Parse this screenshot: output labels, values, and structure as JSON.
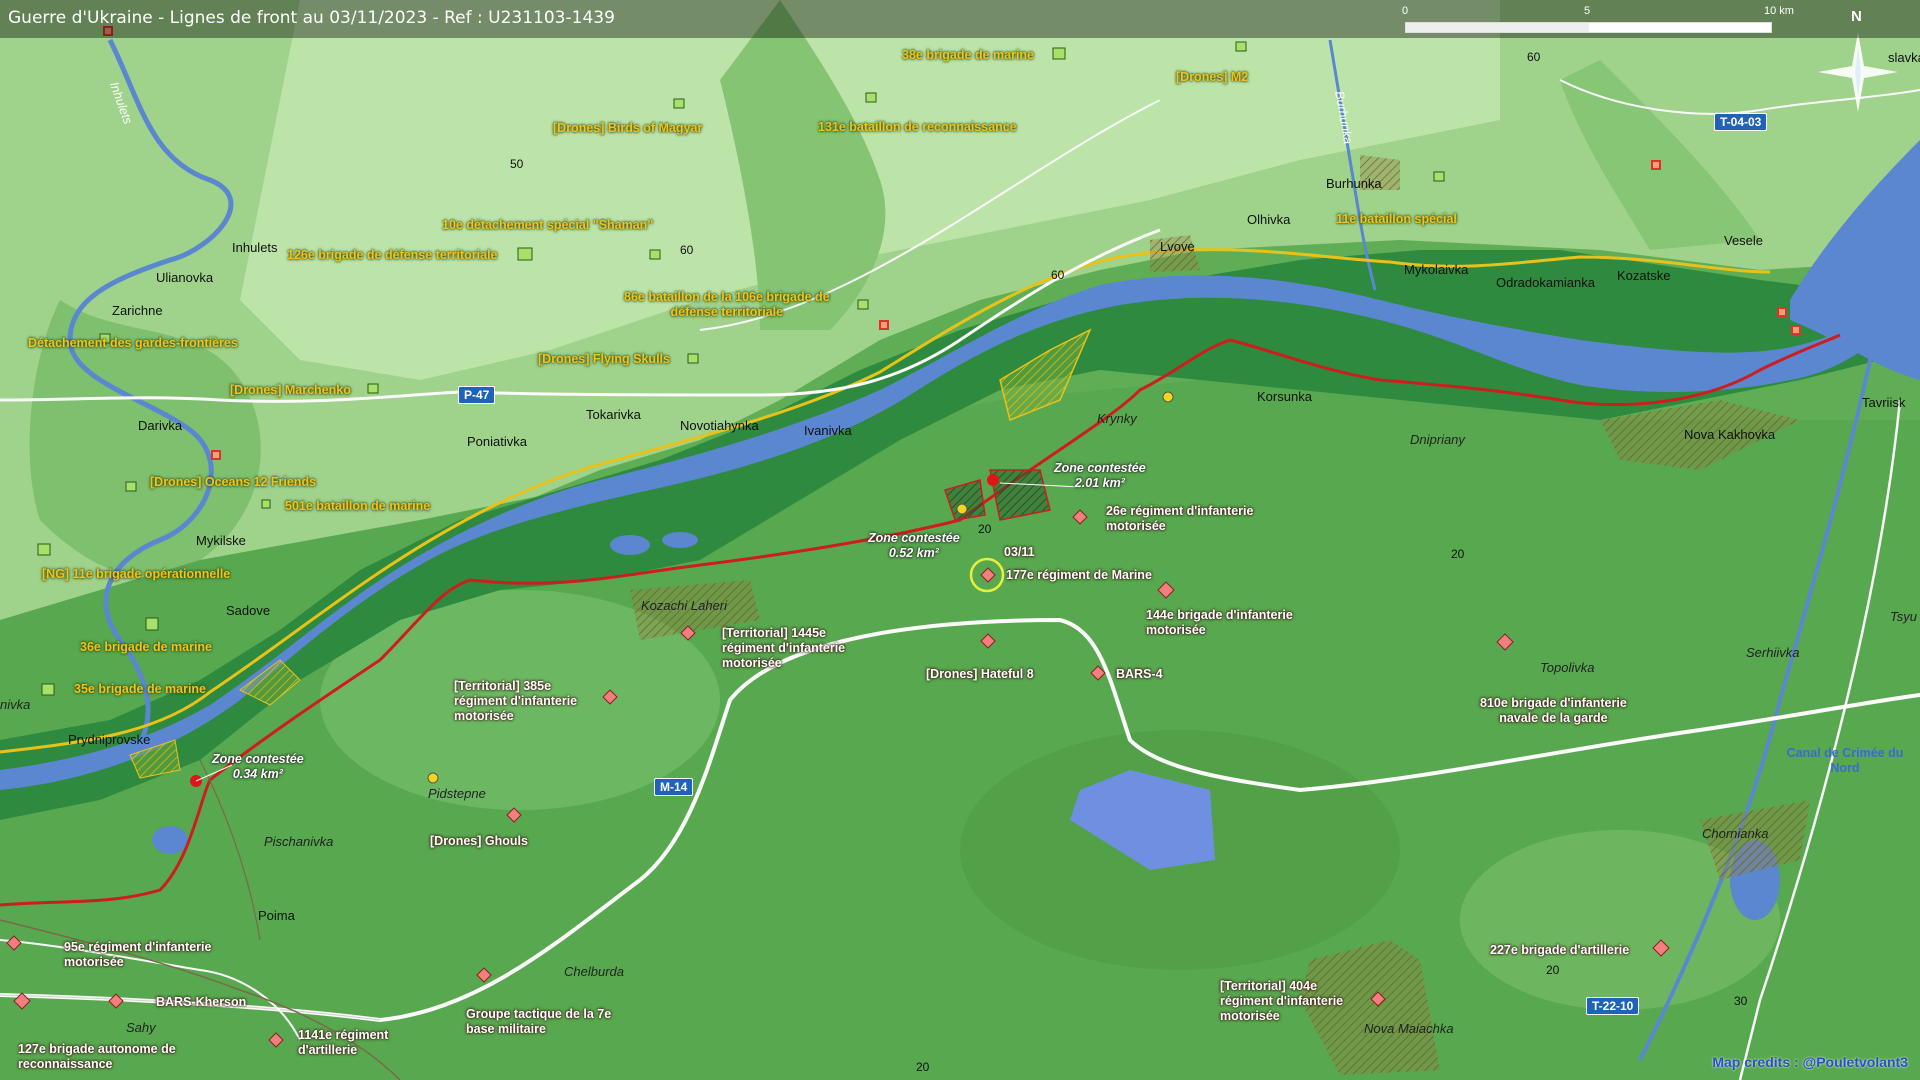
{
  "title": "Guerre d'Ukraine - Lignes de front au 03/11/2023 - Ref : U231103-1439",
  "scale": {
    "l0": "0",
    "l5": "5",
    "l10": "10 km"
  },
  "north": "N",
  "credits": "Map credits : @Pouletvolant3",
  "colors": {
    "frontline": "#cc1e1e",
    "ua_line": "#e8c21a",
    "river": "#5b87d0",
    "ru_unit": "#f17f7f",
    "ua_unit": "#a8e06a"
  },
  "roads": {
    "p47": "P-47",
    "m14": "M-14",
    "t0403": "T-04-03",
    "t2210": "T-22-10"
  },
  "places": {
    "inhulets": "Inhulets",
    "ulianovka": "Ulianovka",
    "zarichne": "Zarichne",
    "darivka": "Darivka",
    "poniativka": "Poniativka",
    "tokarivka": "Tokarivka",
    "novotiahynka": "Novotiahynka",
    "ivanivka": "Ivanivka",
    "mykilske": "Mykilske",
    "sadove": "Sadove",
    "nivka": "nivka",
    "prydniprovske": "Prydniprovske",
    "lvove": "Lvove",
    "olhivka": "Olhivka",
    "burhunka": "Burhunka",
    "mykolaivka": "Mykolaivka",
    "odradokamianka": "Odradokamianka",
    "kozatske": "Kozatske",
    "vesele": "Vesele",
    "krynky": "Krynky",
    "korsunka": "Korsunka",
    "dnipriany": "Dnipriany",
    "nova_kakhovka": "Nova Kakhovka",
    "tavriisk": "Tavriisk",
    "kozachi_laheri": "Kozachi Laheri",
    "pidstepne": "Pidstepne",
    "pishchanivka": "Pischanivka",
    "poima": "Poima",
    "chelburda": "Chelburda",
    "sahy": "Sahy",
    "nova_maiachka": "Nova Maiachka",
    "topolivka": "Topolivka",
    "serhiivka": "Serhiivka",
    "chornianka": "Chornianka",
    "tsyu": "Tsyu",
    "slavka": "slavka"
  },
  "water": {
    "inhulets_river": "Inhulets",
    "burhunka_river": "Burhunka",
    "canal": "Canal de Crimée du Nord"
  },
  "elevations": {
    "e1": "50",
    "e2": "60",
    "e3": "60",
    "e4": "60",
    "e5": "20",
    "e6": "20",
    "e7": "20",
    "e8": "30",
    "e9": "20"
  },
  "zones": {
    "z1": "Zone contestée\n2.01 km²",
    "z2": "Zone contestée\n0.52 km²",
    "z3": "Zone contestée\n0.34 km²"
  },
  "date_tag": "03/11",
  "ua_units": {
    "u1": "38e brigade de marine",
    "u2": "[Drones] M2",
    "u3": "[Drones] Birds of Magyar",
    "u4": "131e bataillon de reconnaissance",
    "u5": "10e détachement spécial \"Shaman\"",
    "u6": "126e brigade de défense territoriale",
    "u7": "86e bataillon de la 106e brigade de\ndéfense territoriale",
    "u8": "Détachement des gardes-frontières",
    "u9": "[Drones] Flying Skulls",
    "u10": "[Drones] Marchenko",
    "u11": "[Drones] Oceans 12 Friends",
    "u12": "501e bataillon de marine",
    "u13": "[NG] 11e brigade opérationnelle",
    "u14": "36e brigade de marine",
    "u15": "35e brigade de marine",
    "u16": "11e bataillon spécial"
  },
  "ru_units": {
    "r1": "26e régiment d'infanterie\nmotorisée",
    "r2": "177e régiment de Marine",
    "r3": "144e brigade d'infanterie\nmotorisée",
    "r4": "[Territorial] 1445e\nrégiment d'infanterie\nmotorisée",
    "r5": "[Drones] Hateful 8",
    "r6": "BARS-4",
    "r7": "[Territorial] 385e\nrégiment d'infanterie\nmotorisée",
    "r8": "810e brigade d'infanterie\nnavale de la garde",
    "r9": "[Drones] Ghouls",
    "r10": "95e régiment d'infanterie\nmotorisée",
    "r11": "BARS-Kherson",
    "r12": "127e brigade autonome de\nreconnaissance",
    "r13": "1141e régiment\nd'artillerie",
    "r14": "Groupe tactique de la 7e\nbase militaire",
    "r15": "[Territorial] 404e\nrégiment d'infanterie\nmotorisée",
    "r16": "227e brigade d'artillerie"
  }
}
